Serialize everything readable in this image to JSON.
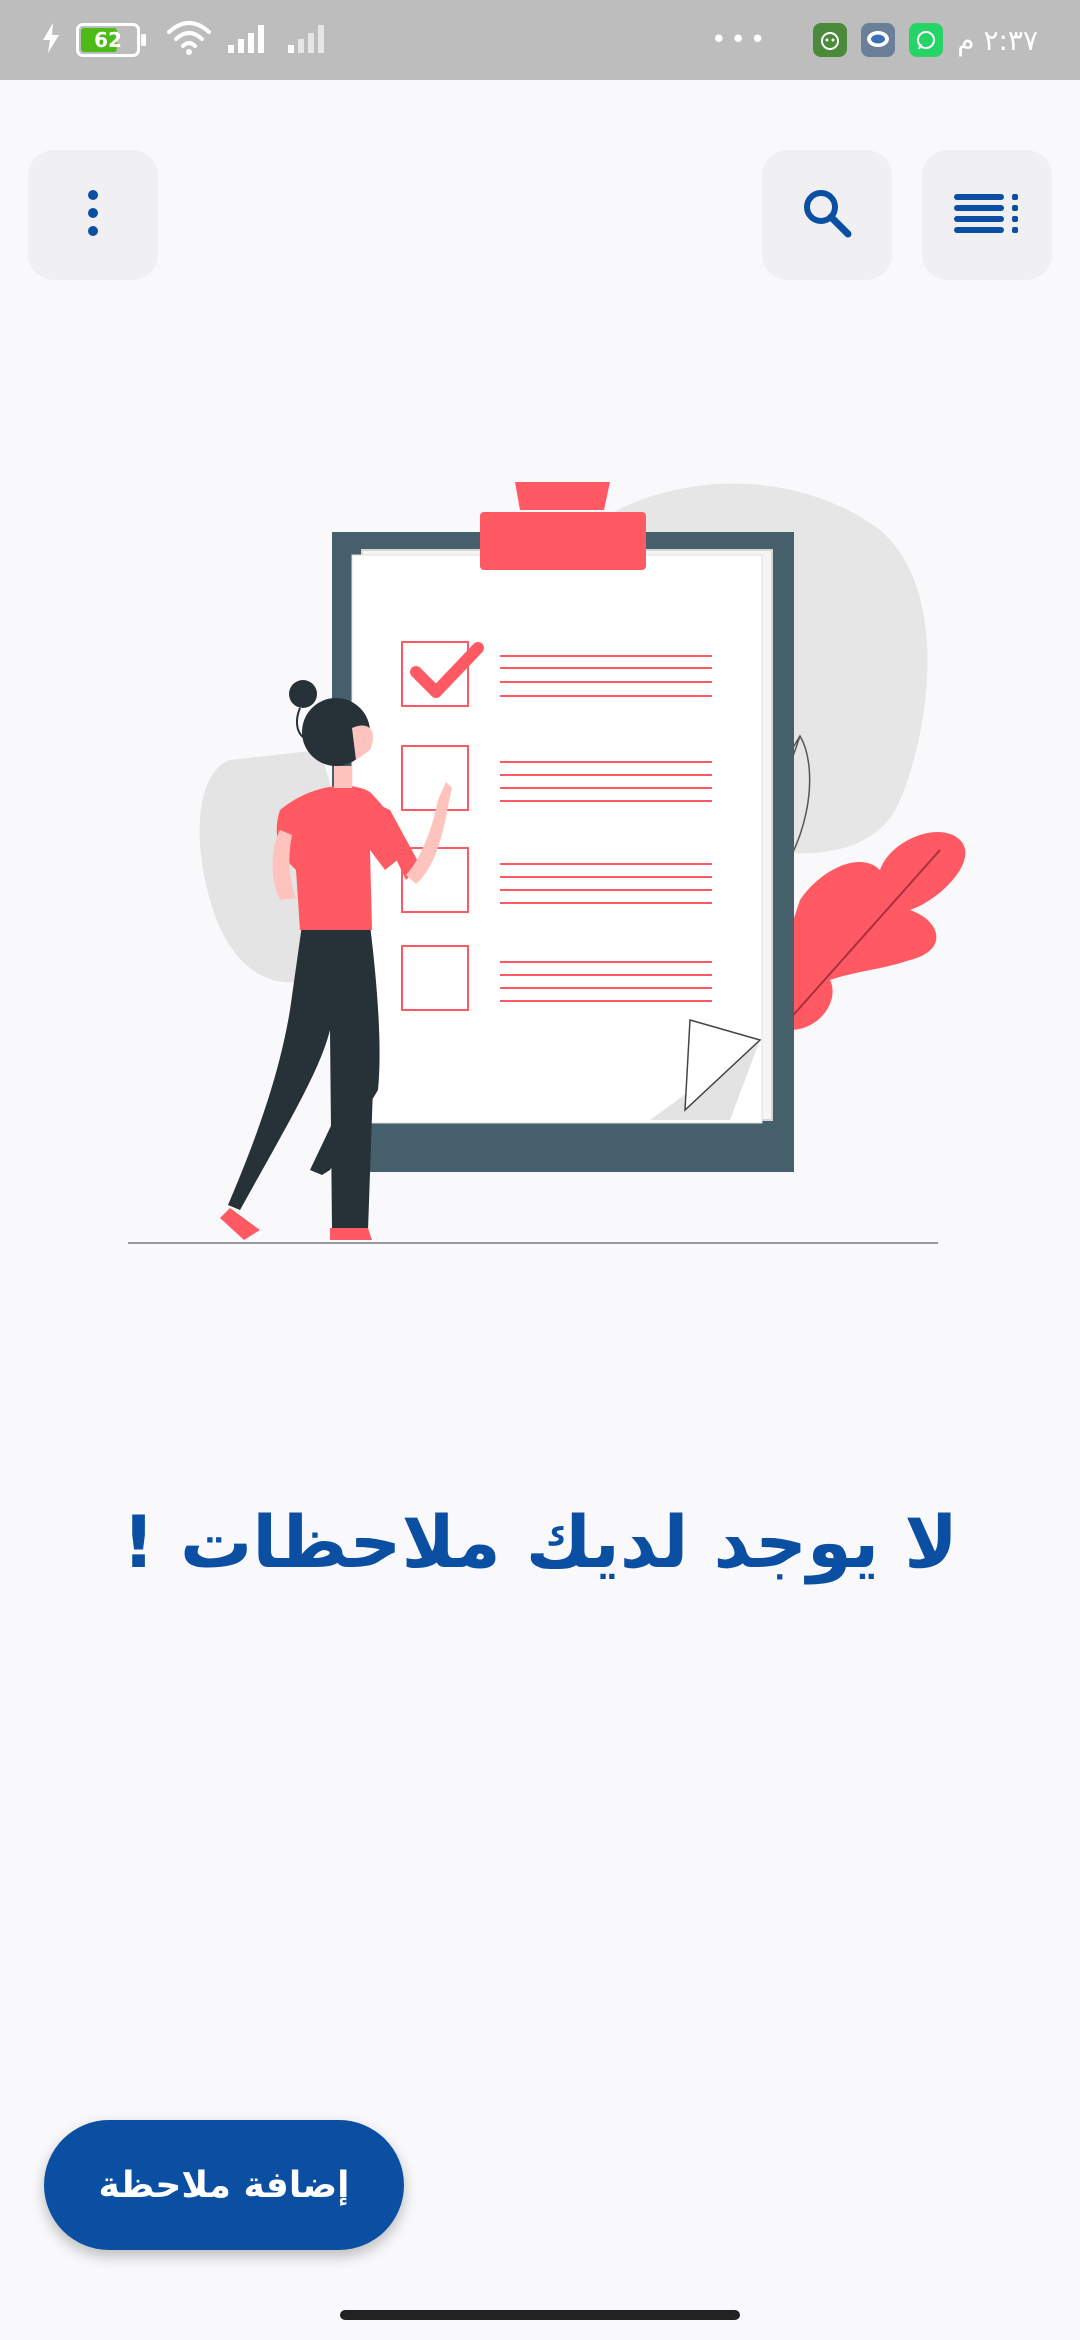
{
  "status_bar": {
    "battery_percent": "62",
    "time": "٢:٣٧ م",
    "overflow_dots": "•••",
    "icons": [
      "charging-icon",
      "battery-icon",
      "wifi-icon",
      "signal-icon",
      "signal-weak-icon",
      "cat-app-icon",
      "chat-app-icon",
      "whatsapp-icon"
    ],
    "colors": {
      "background": "#bdbdbd",
      "battery_fill": "#4cbb17",
      "whatsapp": "#25d366",
      "cat_app": "#4a8a3a"
    }
  },
  "toolbar": {
    "more_icon": "more-vertical-icon",
    "search_icon": "search-icon",
    "menu_icon": "sort-menu-icon"
  },
  "empty_state": {
    "illustration": "clipboard-checklist-illustration",
    "message": "لا يوجد لديك ملاحظات !"
  },
  "fab": {
    "label": "إضافة ملاحظة"
  },
  "theme": {
    "accent": "#0b4fa3",
    "illustration_red": "#ff5a64",
    "clipboard_dark": "#455f6b",
    "page_bg": "#f9f9fb"
  }
}
